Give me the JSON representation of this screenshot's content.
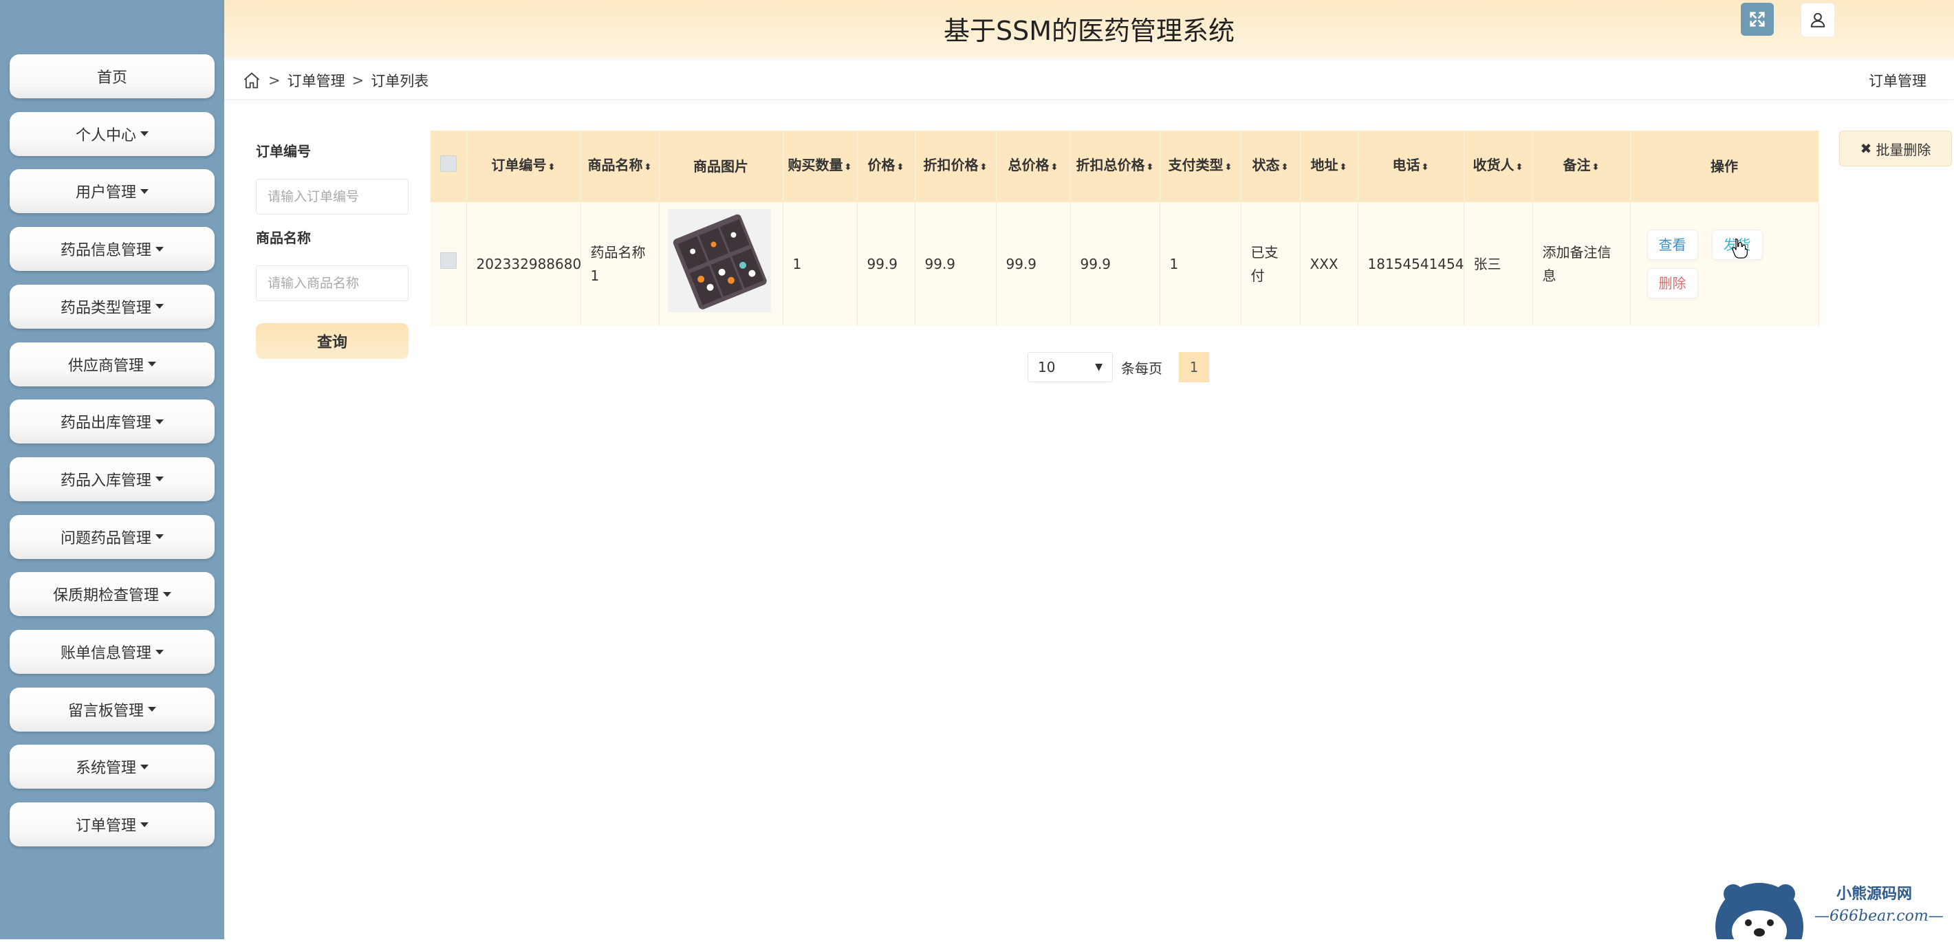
{
  "app": {
    "title": "基于SSM的医药管理系统"
  },
  "header": {
    "fullscreen_icon": "fullscreen-icon",
    "user_icon": "user-icon",
    "accent": "#6f9ab4"
  },
  "sidebar": {
    "background": "#7a9fbb",
    "items": [
      {
        "label": "首页",
        "dropdown": false
      },
      {
        "label": "个人中心",
        "dropdown": true
      },
      {
        "label": "用户管理",
        "dropdown": true
      },
      {
        "label": "药品信息管理",
        "dropdown": true
      },
      {
        "label": "药品类型管理",
        "dropdown": true
      },
      {
        "label": "供应商管理",
        "dropdown": true
      },
      {
        "label": "药品出库管理",
        "dropdown": true
      },
      {
        "label": "药品入库管理",
        "dropdown": true
      },
      {
        "label": "问题药品管理",
        "dropdown": true
      },
      {
        "label": "保质期检查管理",
        "dropdown": true
      },
      {
        "label": "账单信息管理",
        "dropdown": true
      },
      {
        "label": "留言板管理",
        "dropdown": true
      },
      {
        "label": "系统管理",
        "dropdown": true
      },
      {
        "label": "订单管理",
        "dropdown": true
      }
    ]
  },
  "breadcrumb": {
    "home_icon": "home-icon",
    "sep": ">",
    "items": [
      "订单管理",
      "订单列表"
    ],
    "right": "订单管理"
  },
  "search": {
    "order_no_label": "订单编号",
    "order_no_placeholder": "请输入订单编号",
    "product_name_label": "商品名称",
    "product_name_placeholder": "请输入商品名称",
    "query_label": "查询"
  },
  "actions": {
    "batch_delete_label": "批量删除"
  },
  "table": {
    "columns": [
      {
        "label": "订单编号",
        "sortable": true
      },
      {
        "label": "商品名称",
        "sortable": true
      },
      {
        "label": "商品图片",
        "sortable": false
      },
      {
        "label": "购买数量",
        "sortable": true
      },
      {
        "label": "价格",
        "sortable": true
      },
      {
        "label": "折扣价格",
        "sortable": true
      },
      {
        "label": "总价格",
        "sortable": true
      },
      {
        "label": "折扣总价格",
        "sortable": true
      },
      {
        "label": "支付类型",
        "sortable": true
      },
      {
        "label": "状态",
        "sortable": true
      },
      {
        "label": "地址",
        "sortable": true
      },
      {
        "label": "电话",
        "sortable": true
      },
      {
        "label": "收货人",
        "sortable": true
      },
      {
        "label": "备注",
        "sortable": true
      },
      {
        "label": "操作",
        "sortable": false
      }
    ],
    "rows": [
      {
        "order_no": "202332988680",
        "product_name": "药品名称1",
        "image": "pill-organizer-image",
        "qty": "1",
        "price": "99.9",
        "discount_price": "99.9",
        "total": "99.9",
        "discount_total": "99.9",
        "pay_type": "1",
        "status": "已支付",
        "address": "XXX",
        "phone": "18154541454",
        "receiver": "张三",
        "note": "添加备注信息",
        "ops": {
          "view": "查看",
          "ship": "发货",
          "delete": "删除"
        }
      }
    ]
  },
  "pagination": {
    "page_size": "10",
    "per_page_label": "条每页",
    "current_page": "1"
  },
  "watermark": {
    "line1": "小熊源码网",
    "line2": "—666bear.com—"
  }
}
